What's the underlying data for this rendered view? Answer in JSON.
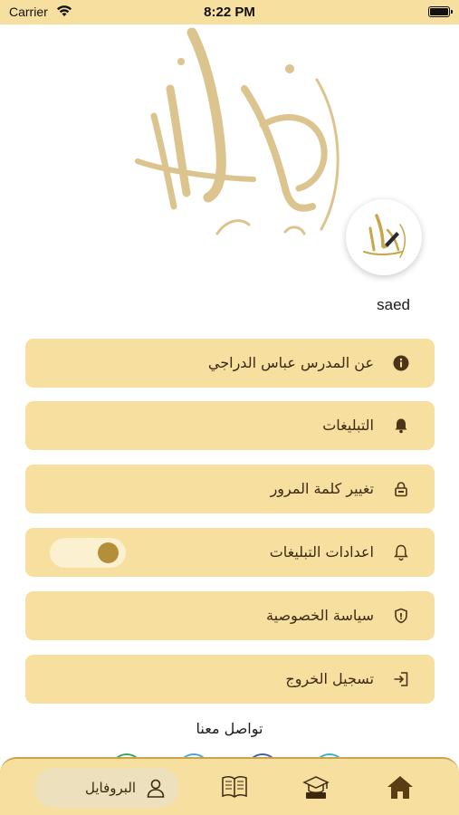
{
  "status_bar": {
    "carrier": "Carrier",
    "time": "8:22 PM"
  },
  "profile": {
    "username": "saed"
  },
  "menu": {
    "items": [
      {
        "label": "عن المدرس عباس الدراجي",
        "icon": "info-icon"
      },
      {
        "label": "التبليغات",
        "icon": "bell-icon"
      },
      {
        "label": "تغيير كلمة المرور",
        "icon": "lock-icon"
      },
      {
        "label": "اعدادات التبليغات",
        "icon": "bell-outline-icon",
        "toggle_on": true
      },
      {
        "label": "سياسة الخصوصية",
        "icon": "shield-icon"
      },
      {
        "label": "تسجيل الخروج",
        "icon": "logout-icon"
      }
    ]
  },
  "contact": {
    "title": "تواصل معنا"
  },
  "bottom_nav": {
    "profile_label": "البروفايل"
  },
  "colors": {
    "accent": "#f6df9f",
    "gold": "#c9a449",
    "brown": "#3b2a10",
    "toggle_knob": "#b48f3a"
  }
}
